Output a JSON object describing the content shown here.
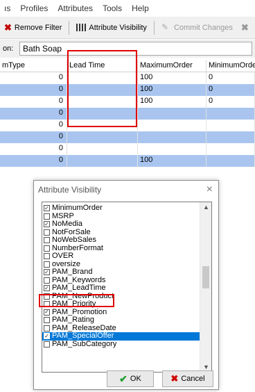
{
  "menu": [
    "ıs",
    "Profiles",
    "Attributes",
    "Tools",
    "Help"
  ],
  "toolbar": {
    "remove_filter": "Remove Filter",
    "attribute_visibility": "Attribute Visibility",
    "commit_changes": "Commit Changes"
  },
  "filter": {
    "label": "on:",
    "value": "Bath Soap"
  },
  "table": {
    "headers": [
      "mType",
      "Lead Time",
      "MaximumOrder",
      "MinimumOrde"
    ],
    "rows": [
      {
        "c1": "0",
        "c2": "",
        "c3": "100",
        "c4": "0",
        "selected": false
      },
      {
        "c1": "0",
        "c2": "",
        "c3": "100",
        "c4": "0",
        "selected": true
      },
      {
        "c1": "0",
        "c2": "",
        "c3": "100",
        "c4": "0",
        "selected": false
      },
      {
        "c1": "0",
        "c2": "",
        "c3": "",
        "c4": "",
        "selected": true
      },
      {
        "c1": "0",
        "c2": "",
        "c3": "",
        "c4": "",
        "selected": false
      },
      {
        "c1": "0",
        "c2": "",
        "c3": "",
        "c4": "",
        "selected": true
      },
      {
        "c1": "0",
        "c2": "",
        "c3": "",
        "c4": "",
        "selected": false
      },
      {
        "c1": "0",
        "c2": "",
        "c3": "100",
        "c4": "",
        "selected": true
      }
    ]
  },
  "dialog": {
    "title": "Attribute Visibility",
    "close": "×",
    "items": [
      {
        "label": "MinimumOrder",
        "checked": true
      },
      {
        "label": "MSRP",
        "checked": false
      },
      {
        "label": "NoMedia",
        "checked": true
      },
      {
        "label": "NotForSale",
        "checked": false
      },
      {
        "label": "NoWebSales",
        "checked": false
      },
      {
        "label": "NumberFormat",
        "checked": false
      },
      {
        "label": "OVER",
        "checked": false
      },
      {
        "label": "oversize",
        "checked": false
      },
      {
        "label": "PAM_Brand",
        "checked": true
      },
      {
        "label": "PAM_Keywords",
        "checked": false
      },
      {
        "label": "PAM_LeadTime",
        "checked": true
      },
      {
        "label": "PAM_NewProduct",
        "checked": false
      },
      {
        "label": "PAM_Priority",
        "checked": false
      },
      {
        "label": "PAM_Promotion",
        "checked": true
      },
      {
        "label": "PAM_Rating",
        "checked": false
      },
      {
        "label": "PAM_ReleaseDate",
        "checked": false
      },
      {
        "label": "PAM_SpecialOffer",
        "checked": true,
        "selected": true
      },
      {
        "label": "PAM_SubCategory",
        "checked": false
      }
    ],
    "ok": "OK",
    "cancel": "Cancel"
  }
}
